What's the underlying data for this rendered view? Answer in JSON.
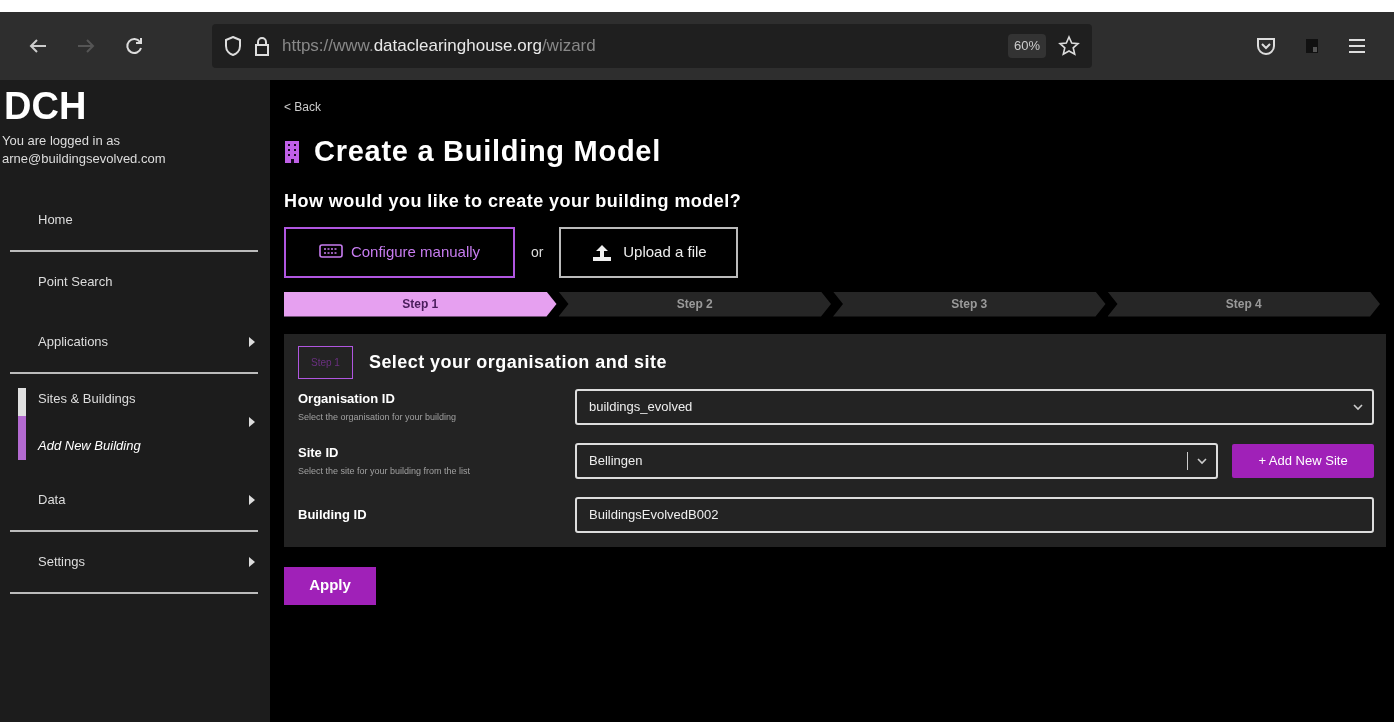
{
  "browser": {
    "url_prefix": "https://www.",
    "url_domain": "dataclearinghouse.org",
    "url_path": "/wizard",
    "zoom": "60%"
  },
  "sidebar": {
    "logo": "DCH",
    "login_line": "You are logged in as",
    "email": "arne@buildingsevolved.com",
    "items": [
      {
        "label": "Home",
        "has_submenu": false,
        "divider_below": true
      },
      {
        "label": "Point Search",
        "has_submenu": false,
        "divider_below": false
      },
      {
        "label": "Applications",
        "has_submenu": true,
        "divider_below": true
      },
      {
        "label": "Sites & Buildings",
        "has_submenu": true,
        "divider_below": false,
        "children": [
          {
            "label": "Add New Building",
            "selected": true
          }
        ]
      },
      {
        "label": "Data",
        "has_submenu": true,
        "divider_below": true
      },
      {
        "label": "Settings",
        "has_submenu": true,
        "divider_below": true
      }
    ]
  },
  "back_link": "< Back",
  "title": "Create a Building Model",
  "question": "How would you like to create your building model?",
  "methods": [
    {
      "kind": "keyboard",
      "label": "Configure manually",
      "selected": true
    },
    {
      "kind": "upload",
      "label": "Upload a file",
      "selected": false
    }
  ],
  "or_text": "or",
  "steps": [
    {
      "label": "Step 1",
      "selected": true
    },
    {
      "label": "Step 2",
      "selected": false
    },
    {
      "label": "Step 3",
      "selected": false
    },
    {
      "label": "Step 4",
      "selected": false
    }
  ],
  "card": {
    "step_badge": "Step 1",
    "heading": "Select your organisation and site",
    "fields": [
      {
        "kind": "select",
        "label": "Organisation ID",
        "hint": "Select the organisation for your building",
        "value": "buildings_evolved"
      },
      {
        "kind": "select_add",
        "label": "Site ID",
        "hint": "Select the site for your building from the list",
        "value": "Bellingen",
        "action": "+ Add New Site"
      },
      {
        "kind": "text",
        "label": "Building ID",
        "value": "BuildingsEvolvedB002"
      }
    ]
  },
  "apply_button": "Apply"
}
